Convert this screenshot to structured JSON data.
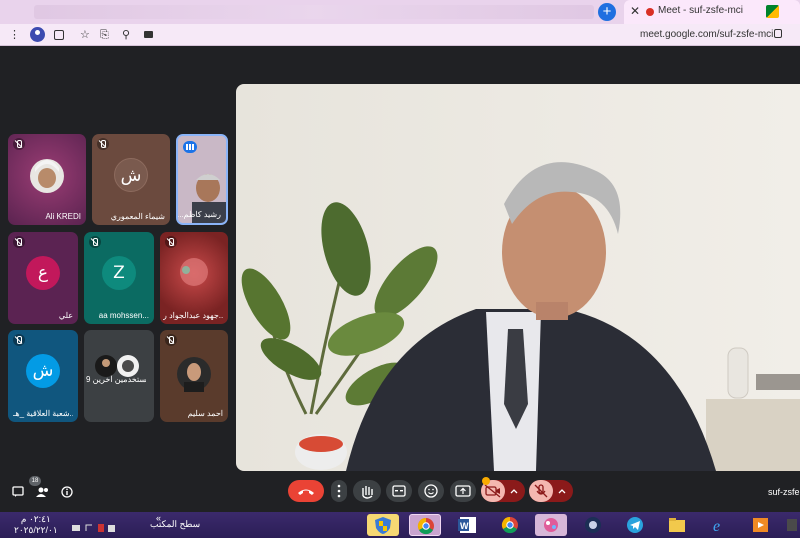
{
  "browser": {
    "active_tab_title": "Meet - suf-zsfe-mci",
    "url": "meet.google.com/suf-zsfe-mci"
  },
  "participants": [
    {
      "name": "Ali KREDI",
      "muted": true
    },
    {
      "name": "شيماء المعموري",
      "avatar_letter": "ش",
      "avatar_color": "#7a5a4e",
      "muted": true
    },
    {
      "name": "...رشيد كاظم",
      "speaking": true
    },
    {
      "name": "علي",
      "avatar_letter": "ع",
      "avatar_color": "#c2185b",
      "muted": true
    },
    {
      "name": "aa mohssen...",
      "avatar_letter": "Z",
      "avatar_color": "#0e8a7d",
      "muted": true
    },
    {
      "name": "جهود عبدالجواد ر...",
      "muted": true
    },
    {
      "name": "شعبة العلاقية _هـ...",
      "avatar_letter": "ش",
      "avatar_color": "#039be5",
      "muted": true
    },
    {
      "name": "9 مستخدمين آخرين"
    },
    {
      "name": "احمد سليم",
      "muted": true
    }
  ],
  "controls": {
    "participant_count": "18",
    "meeting_code": "suf-zsfe"
  },
  "taskbar": {
    "time": "٠٢:٤١ م",
    "date": "٢٠٢٥/٢٢/٠١",
    "desktop_label": "سطح المكتب"
  },
  "colors": {
    "meet_bg": "#202124",
    "end_call": "#ea4335",
    "muted_red": "#8b1a1a",
    "tab_bar": "#e9d3ec",
    "taskbar": "#2b1e56"
  }
}
